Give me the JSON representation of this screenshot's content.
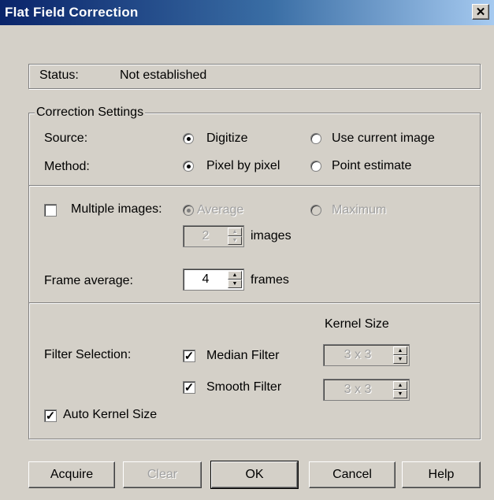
{
  "window": {
    "title": "Flat Field Correction",
    "close_symbol": "✕"
  },
  "status": {
    "label": "Status:",
    "value": "Not established"
  },
  "correction": {
    "legend": "Correction Settings",
    "source": {
      "label": "Source:",
      "option1": "Digitize",
      "option2": "Use current image",
      "selected": "Digitize"
    },
    "method": {
      "label": "Method:",
      "option1": "Pixel by pixel",
      "option2": "Point estimate",
      "selected": "Pixel by pixel"
    }
  },
  "multiple": {
    "label": "Multiple images:",
    "checked": false,
    "option1": "Average",
    "option2": "Maximum",
    "images_value": "2",
    "images_unit": "images"
  },
  "frame": {
    "label": "Frame average:",
    "value": "4",
    "unit": "frames"
  },
  "filter": {
    "kernel_header": "Kernel Size",
    "label": "Filter Selection:",
    "median": {
      "label": "Median Filter",
      "checked": true,
      "kernel": "3 x 3"
    },
    "smooth": {
      "label": "Smooth Filter",
      "checked": true,
      "kernel": "3 x 3"
    },
    "auto": {
      "label": "Auto Kernel Size",
      "checked": true
    }
  },
  "buttons": {
    "acquire": "Acquire",
    "clear": "Clear",
    "ok": "OK",
    "cancel": "Cancel",
    "help": "Help"
  },
  "symbols": {
    "check": "✓",
    "spin_up": "▲",
    "spin_down": "▼"
  },
  "colors": {
    "face": "#d4d0c8",
    "title_start": "#0a246a",
    "title_end": "#a6caf0",
    "disabled_text": "#a0a0a0"
  }
}
